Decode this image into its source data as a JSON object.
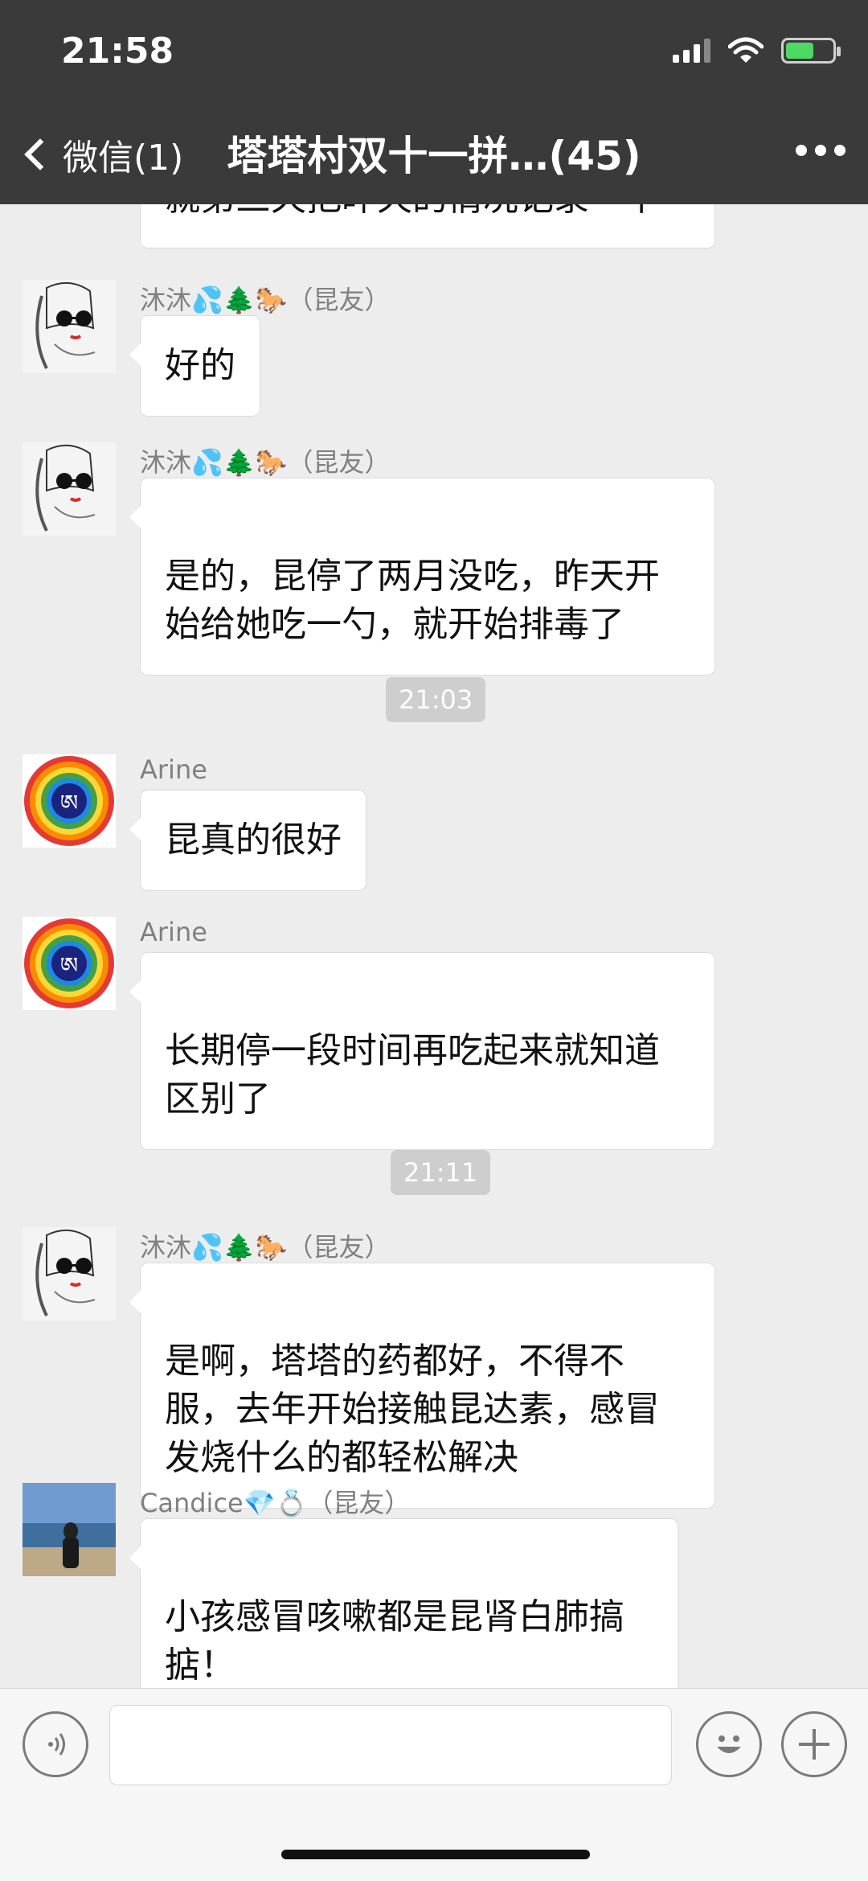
{
  "status": {
    "time": "21:58"
  },
  "nav": {
    "back_label": "微信(1)",
    "title": "塔塔村双十一拼…(45)"
  },
  "messages": [
    {
      "id": "m0",
      "sender": "",
      "text": "就第三天把昨天的情况记录一下"
    },
    {
      "id": "m1",
      "sender": "沐沐💦🌲🐎（昆友）",
      "text": "好的"
    },
    {
      "id": "m2",
      "sender": "沐沐💦🌲🐎（昆友）",
      "text": "是的，昆停了两月没吃，昨天开\n始给她吃一勺，就开始排毒了"
    },
    {
      "id": "t1",
      "time": "21:03"
    },
    {
      "id": "m3",
      "sender": "Arine",
      "text": "昆真的很好"
    },
    {
      "id": "m4",
      "sender": "Arine",
      "text": "长期停一段时间再吃起来就知道\n区别了"
    },
    {
      "id": "t2",
      "time": "21:11"
    },
    {
      "id": "m5",
      "sender": "沐沐💦🌲🐎（昆友）",
      "text": "是啊，塔塔的药都好，不得不\n服，去年开始接触昆达素，感冒\n发烧什么的都轻松解决"
    },
    {
      "id": "m6",
      "sender": "Candice💎💍（昆友）",
      "text": "小孩感冒咳嗽都是昆肾白肺搞\n掂！"
    }
  ],
  "avatars": {
    "rainbow_glyph": "ཨ"
  },
  "input": {
    "placeholder": ""
  },
  "icons": [
    "back-chevron-icon",
    "more-icon",
    "signal-icon",
    "wifi-icon",
    "battery-icon",
    "voice-icon",
    "emoji-icon",
    "plus-icon"
  ],
  "colors": {
    "header": "#3a3a3a",
    "background": "#ededed",
    "bubble": "#ffffff",
    "battery_fill": "#4cd964"
  }
}
